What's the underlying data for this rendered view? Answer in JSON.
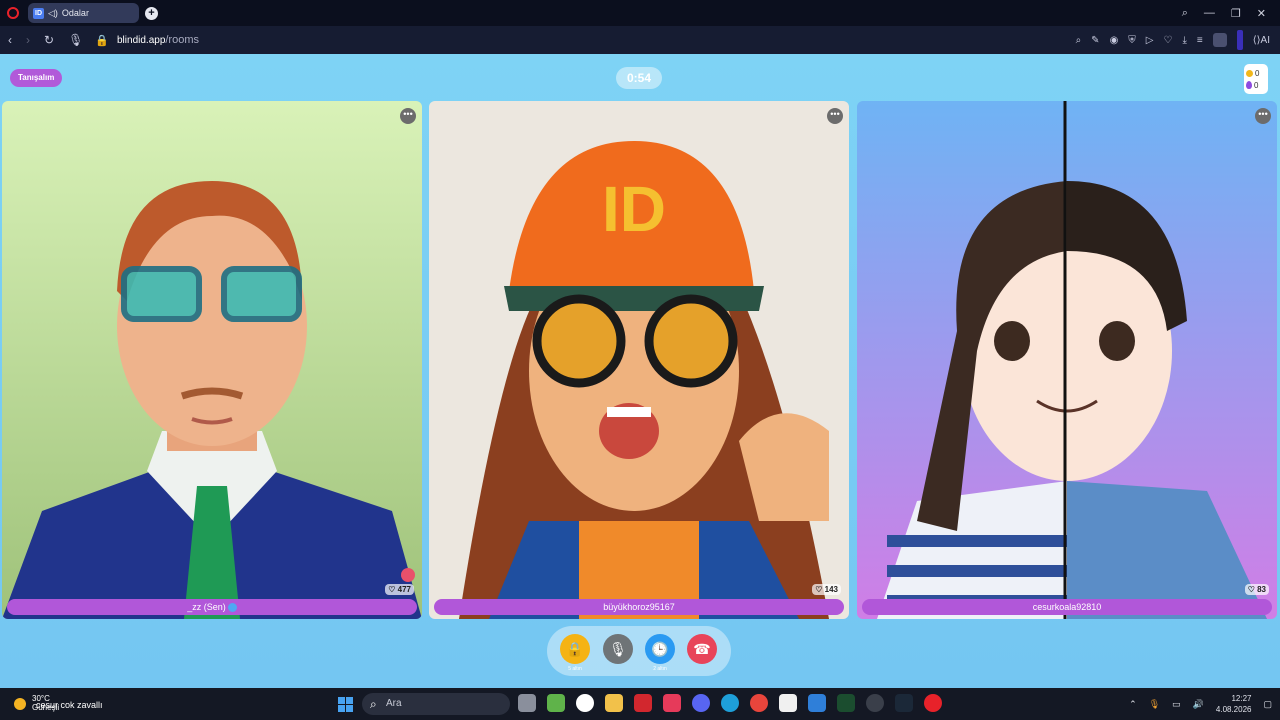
{
  "browser": {
    "tab_title": "Odalar",
    "tab_favicon": "ID",
    "url_domain": "blindid.app",
    "url_path": "/rooms",
    "ai_label": "AI"
  },
  "app": {
    "tanis_label": "Tanışalım",
    "timer": "0:54",
    "coins": "0",
    "gems": "0",
    "cards": [
      {
        "name": "_zz (Sen)",
        "likes": "♡ 477"
      },
      {
        "name": "büyükhoroz95167",
        "likes": "♡ 143"
      },
      {
        "name": "cesurkoala92810",
        "likes": "♡ 83"
      }
    ],
    "card_avatar_text": "ID",
    "controls": {
      "lock_label": "5 altın",
      "timer_label": "2 altın"
    }
  },
  "taskbar": {
    "weather_temp": "30°C",
    "weather_desc": "Güneşli",
    "overlay_text": "cesur cok zavallı",
    "search_placeholder": "Ara",
    "time": "12:27",
    "date": "4.08.2026"
  },
  "colors": {
    "accent_purple": "#b157d9",
    "bg_blue": "#7ed3f5",
    "lock_yellow": "#f5b314",
    "timer_blue": "#2a9af2",
    "hangup_red": "#e8445a"
  }
}
